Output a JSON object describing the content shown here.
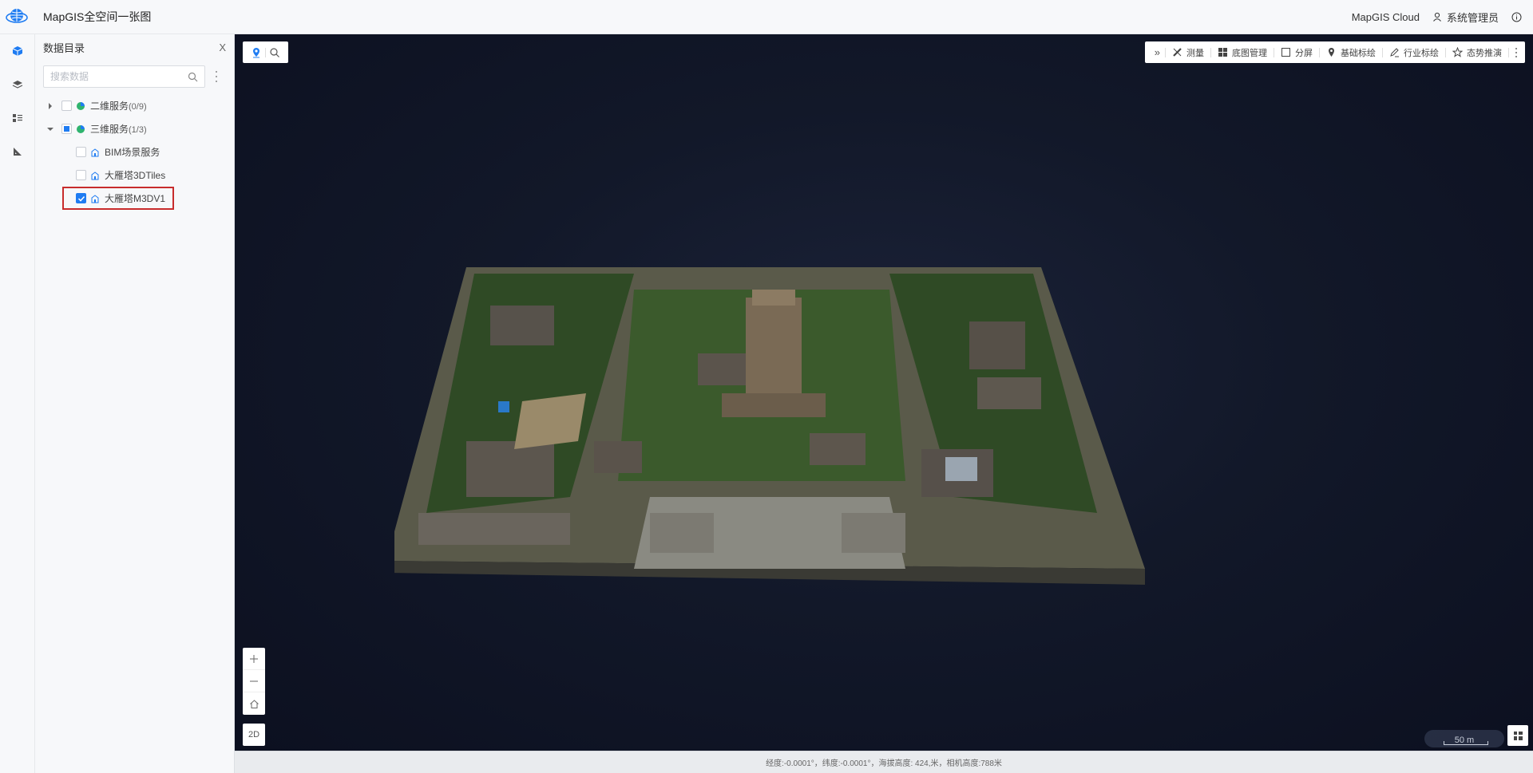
{
  "header": {
    "app_title": "MapGIS全空间一张图",
    "brand": "MapGIS Cloud",
    "user": "系统管理员"
  },
  "panel": {
    "title": "数据目录",
    "close": "X",
    "search_placeholder": "搜索数据"
  },
  "tree": {
    "group_2d": {
      "label": "二维服务",
      "count": "(0/9)"
    },
    "group_3d": {
      "label": "三维服务",
      "count": "(1/3)"
    },
    "children": [
      {
        "label": "BIM场景服务",
        "checked": false
      },
      {
        "label": "大雁塔3DTiles",
        "checked": false
      },
      {
        "label": "大雁塔M3DV1",
        "checked": true
      }
    ]
  },
  "toolbar": {
    "expand": "»",
    "measure": "测量",
    "basemap": "底图管理",
    "split": "分屏",
    "basic_mark": "基础标绘",
    "industry_mark": "行业标绘",
    "situation": "态势推演"
  },
  "map": {
    "mode_2d": "2D",
    "scale": "50 m",
    "status": "经度:-0.0001°，纬度:-0.0001°，海拔高度: 424,米，相机高度:788米"
  },
  "colors": {
    "accent": "#1f7cf2",
    "highlight": "#c82c2c",
    "map_bg": "#121829"
  }
}
